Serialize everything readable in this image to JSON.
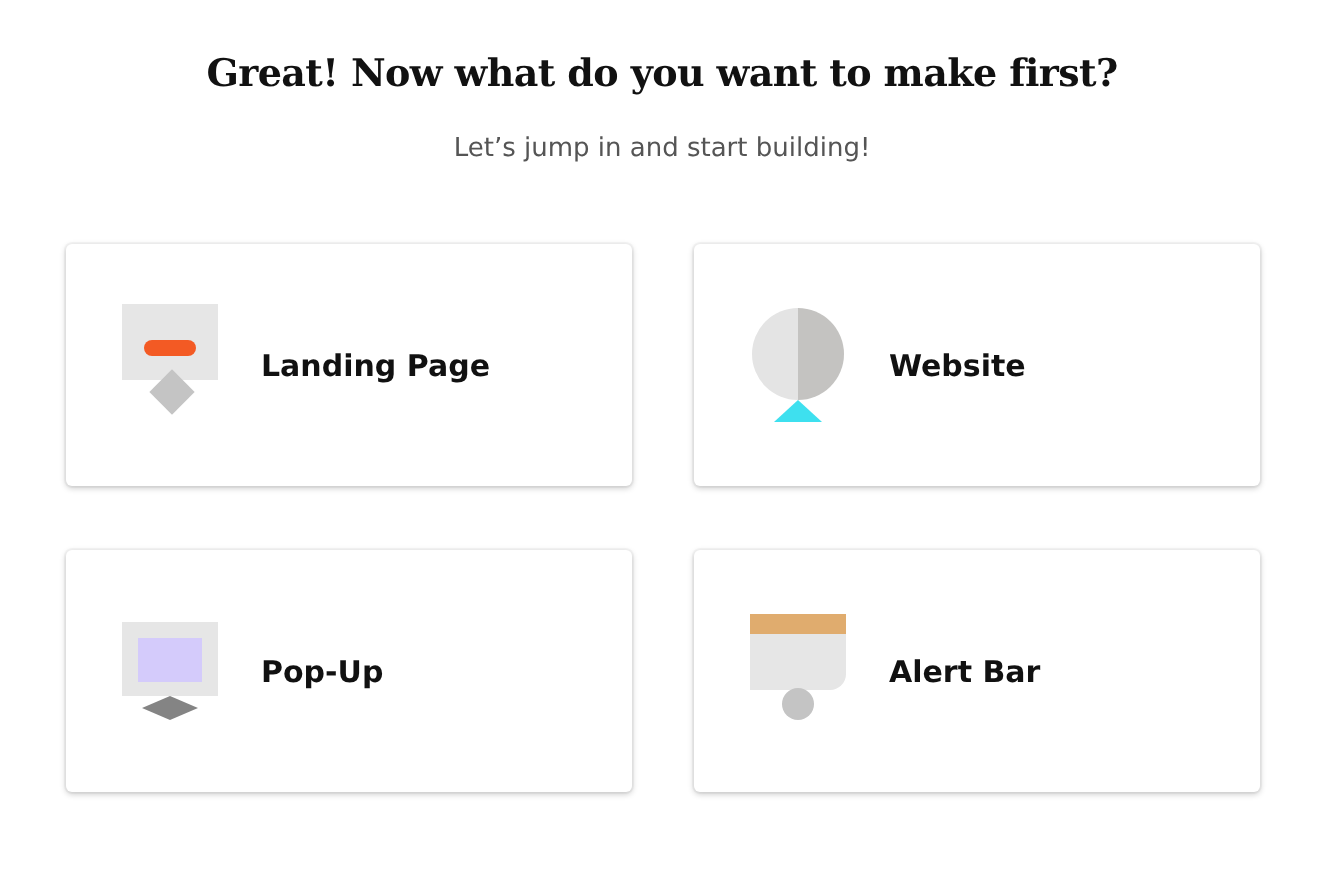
{
  "heading": "Great! Now what do you want to make first?",
  "subheading": "Let’s jump in and start building!",
  "options": [
    {
      "kind": "landing",
      "label": "Landing Page"
    },
    {
      "kind": "website",
      "label": "Website"
    },
    {
      "kind": "popup",
      "label": "Pop-Up"
    },
    {
      "kind": "alert",
      "label": "Alert Bar"
    }
  ]
}
